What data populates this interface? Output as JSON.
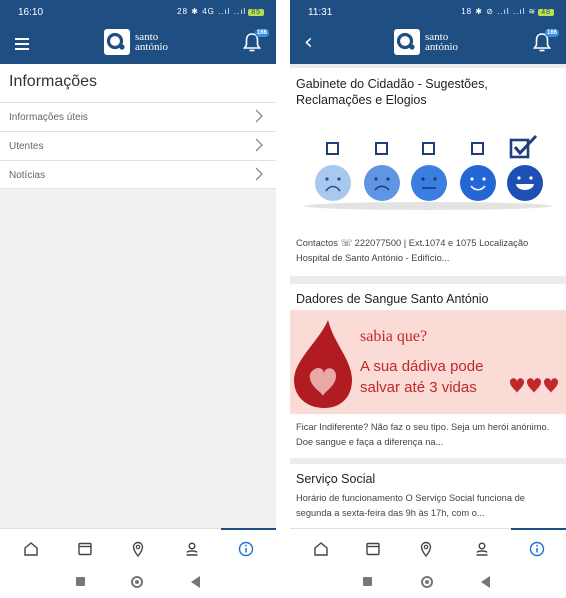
{
  "left": {
    "status": {
      "time": "16:10",
      "icons": "28 ✱ 4G ..ıl ..ıl",
      "battery": "85"
    },
    "bell_badge": "166",
    "logo": {
      "line1": "santo",
      "line2": "antónio"
    },
    "page_title": "Informações",
    "menu": [
      {
        "label": "Informações úteis"
      },
      {
        "label": "Utentes"
      },
      {
        "label": "Notícias"
      }
    ]
  },
  "right": {
    "status": {
      "time": "11:31",
      "icons": "18 ✱ ⊘ ..ıl ..ıl ≋",
      "battery": "48"
    },
    "bell_badge": "166",
    "logo": {
      "line1": "santo",
      "line2": "antónio"
    },
    "cards": [
      {
        "title": "Gabinete do Cidadão - Sugestões, Reclamações e Elogios",
        "text": "Contactos ☏ 222077500 | Ext.1074 e 1075 Localização Hospital de Santo António - Edifício..."
      },
      {
        "title": "Dadores de Sangue Santo António",
        "banner_line1": "sabia que?",
        "banner_line2": "A sua dádiva pode",
        "banner_line3": "salvar até 3 vidas",
        "text": "Ficar Indiferente? Não faz o seu tipo. Seja um herói anónimo. Doe sangue e faça a diferença na..."
      },
      {
        "title": "Serviço Social",
        "text": "Horário de funcionamento O Serviço Social funciona de segunda a sexta-feira das 9h às 17h, com o..."
      }
    ]
  },
  "colors": {
    "primary": "#1f4e82",
    "mood": [
      "#a9c8ef",
      "#5f95e4",
      "#3a7fe0",
      "#2566d6",
      "#1e4fb5"
    ],
    "blood": "#c0282b"
  },
  "icons": {
    "nav": [
      "home-icon",
      "calendar-icon",
      "location-icon",
      "profile-icon",
      "info-icon"
    ]
  }
}
